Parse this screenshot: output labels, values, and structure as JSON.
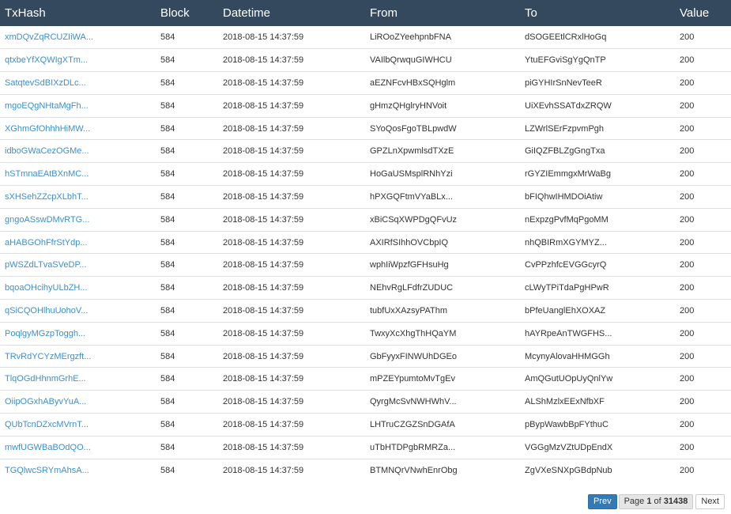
{
  "table": {
    "columns": [
      "TxHash",
      "Block",
      "Datetime",
      "From",
      "To",
      "Value"
    ],
    "rows": [
      {
        "txhash": "xmDQvZqRCUZIiWA...",
        "block": "584",
        "datetime": "2018-08-15 14:37:59",
        "from": "LiROoZYeehpnbFNA",
        "to": "dSOGEEtlCRxlHoGq",
        "value": "200"
      },
      {
        "txhash": "qtxbeYfXQWIgXTm...",
        "block": "584",
        "datetime": "2018-08-15 14:37:59",
        "from": "VAIlbQrwquGIWHCU",
        "to": "YtuEFGviSgYgQnTP",
        "value": "200"
      },
      {
        "txhash": "SatqtevSdBIXzDLc...",
        "block": "584",
        "datetime": "2018-08-15 14:37:59",
        "from": "aEZNFcvHBxSQHglm",
        "to": "piGYHIrSnNevTeeR",
        "value": "200"
      },
      {
        "txhash": "mgoEQgNHtaMgFh...",
        "block": "584",
        "datetime": "2018-08-15 14:37:59",
        "from": "gHmzQHglryHNVoit",
        "to": "UiXEvhSSATdxZRQW",
        "value": "200"
      },
      {
        "txhash": "XGhmGfOhhhHiMW...",
        "block": "584",
        "datetime": "2018-08-15 14:37:59",
        "from": "SYoQosFgoTBLpwdW",
        "to": "LZWrlSErFzpvmPgh",
        "value": "200"
      },
      {
        "txhash": "idboGWaCezOGMe...",
        "block": "584",
        "datetime": "2018-08-15 14:37:59",
        "from": "GPZLnXpwmlsdTXzE",
        "to": "GiIQZFBLZgGngTxa",
        "value": "200"
      },
      {
        "txhash": "hSTmnaEAtBXnMC...",
        "block": "584",
        "datetime": "2018-08-15 14:37:59",
        "from": "HoGaUSMsplRNhYzi",
        "to": "rGYZIEmmgxMrWaBg",
        "value": "200"
      },
      {
        "txhash": "sXHSehZZcpXLbhT...",
        "block": "584",
        "datetime": "2018-08-15 14:37:59",
        "from": "hPXGQFtmVYaBLx...",
        "to": "bFIQhwIHMDOiAtiw",
        "value": "200"
      },
      {
        "txhash": "gngoASswDMvRTG...",
        "block": "584",
        "datetime": "2018-08-15 14:37:59",
        "from": "xBiCSqXWPDgQFvUz",
        "to": "nExpzgPvfMqPgoMM",
        "value": "200"
      },
      {
        "txhash": "aHABGOhFfrStYdp...",
        "block": "584",
        "datetime": "2018-08-15 14:37:59",
        "from": "AXIRfSIhhOVCbpIQ",
        "to": "nhQBIRmXGYMYZ...",
        "value": "200"
      },
      {
        "txhash": "pWSZdLTvaSVeDP...",
        "block": "584",
        "datetime": "2018-08-15 14:37:59",
        "from": "wphIiWpzfGFHsuHg",
        "to": "CvPPzhfcEVGGcyrQ",
        "value": "200"
      },
      {
        "txhash": "bqoaOHcihyULbZH...",
        "block": "584",
        "datetime": "2018-08-15 14:37:59",
        "from": "NEhvRgLFdfrZUDUC",
        "to": "cLWyTPiTdaPgHPwR",
        "value": "200"
      },
      {
        "txhash": "qSiCQOHlhuUohoV...",
        "block": "584",
        "datetime": "2018-08-15 14:37:59",
        "from": "tubfUxXAzsyPAThm",
        "to": "bPfeUanglEhXOXAZ",
        "value": "200"
      },
      {
        "txhash": "PoqlgyMGzpToggh...",
        "block": "584",
        "datetime": "2018-08-15 14:37:59",
        "from": "TwxyXcXhgThHQaYM",
        "to": "hAYRpeAnTWGFHS...",
        "value": "200"
      },
      {
        "txhash": "TRvRdYCYzMErgzft...",
        "block": "584",
        "datetime": "2018-08-15 14:37:59",
        "from": "GbFyyxFINWUhDGEo",
        "to": "McynyAlovaHHMGGh",
        "value": "200"
      },
      {
        "txhash": "TlqOGdHhnmGrhE...",
        "block": "584",
        "datetime": "2018-08-15 14:37:59",
        "from": "mPZEYpumtoMvTgEv",
        "to": "AmQGutUOpUyQnlYw",
        "value": "200"
      },
      {
        "txhash": "OiipOGxhAByvYuA...",
        "block": "584",
        "datetime": "2018-08-15 14:37:59",
        "from": "QyrgMcSvNWHWhV...",
        "to": "ALShMzlxEExNfbXF",
        "value": "200"
      },
      {
        "txhash": "QUbTcnDZxcMVrnT...",
        "block": "584",
        "datetime": "2018-08-15 14:37:59",
        "from": "LHTruCZGZSnDGAfA",
        "to": "pBypWawbBpFYthuC",
        "value": "200"
      },
      {
        "txhash": "mwfUGWBaBOdQO...",
        "block": "584",
        "datetime": "2018-08-15 14:37:59",
        "from": "uTbHTDPgbRMRZa...",
        "to": "VGGgMzVZtUDpEndX",
        "value": "200"
      },
      {
        "txhash": "TGQlwcSRYmAhsA...",
        "block": "584",
        "datetime": "2018-08-15 14:37:59",
        "from": "BTMNQrVNwhEnrObg",
        "to": "ZgVXeSNXpGBdpNub",
        "value": "200"
      }
    ]
  },
  "pagination": {
    "prev_label": "Prev",
    "page_word": "Page",
    "current_page": "1",
    "of_word": "of",
    "total_pages": "31438",
    "next_label": "Next"
  },
  "colors": {
    "header_bg": "#34495e",
    "link": "#3a8fd0",
    "prev_button": "#337ab7"
  }
}
